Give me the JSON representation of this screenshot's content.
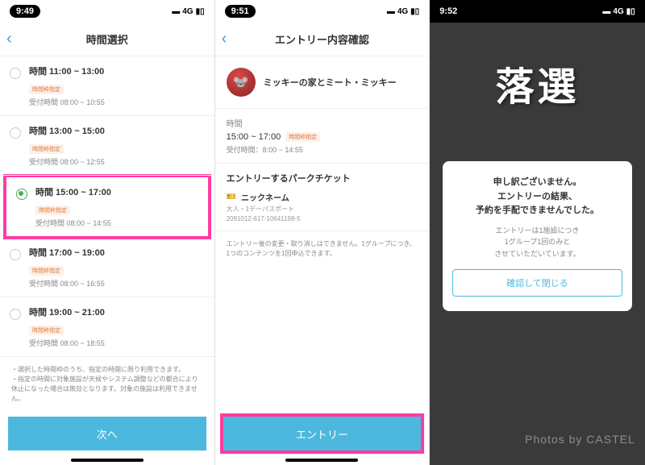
{
  "screen1": {
    "time": "9:49",
    "signal": "4G",
    "title": "時間選択",
    "slots": [
      {
        "title": "時間 11:00 ~ 13:00",
        "badge": "時間枠指定",
        "sub": "受付時間 08:00 ~ 10:55",
        "selected": false
      },
      {
        "title": "時間 13:00 ~ 15:00",
        "badge": "時間枠指定",
        "sub": "受付時間 08:00 ~ 12:55",
        "selected": false
      },
      {
        "title": "時間 15:00 ~ 17:00",
        "badge": "時間枠指定",
        "sub": "受付時間 08:00 ~ 14:55",
        "selected": true
      },
      {
        "title": "時間 17:00 ~ 19:00",
        "badge": "時間枠指定",
        "sub": "受付時間 08:00 ~ 16:55",
        "selected": false
      },
      {
        "title": "時間 19:00 ~ 21:00",
        "badge": "時間枠指定",
        "sub": "受付時間 08:00 ~ 18:55",
        "selected": false
      }
    ],
    "note1": "・選択した時間枠のうち、指定の時間に限り利用できます。",
    "note2": "・指定の時間に対象施設が天候やシステム調整などの都合により休止になった場合は無効となります。対象の施設は利用できません。",
    "next_btn": "次へ"
  },
  "screen2": {
    "time": "9:51",
    "signal": "4G",
    "title": "エントリー内容確認",
    "attraction_name": "ミッキーの家とミート・ミッキー",
    "time_label": "時間",
    "time_value": "15:00 ~ 17:00",
    "time_badge": "時間枠指定",
    "reception": "受付時間：8:00 ~ 14:55",
    "ticket_title": "エントリーするパークチケット",
    "ticket_name": "ニックネーム",
    "ticket_type": "大人・1デーパスポート",
    "ticket_id": "2091012-617-10641198-5",
    "warning": "エントリー後の変更・取り消しはできません。1グループにつき、1つのコンテンツを1回申込できます。",
    "entry_btn": "エントリー"
  },
  "screen3": {
    "time": "9:52",
    "signal": "4G",
    "big_text": "落選",
    "modal_line1": "申し訳ございません。",
    "modal_line2": "エントリーの結果、",
    "modal_line3": "予約を手配できませんでした。",
    "modal_sub1": "エントリーは1施設につき",
    "modal_sub2": "1グループ1回のみと",
    "modal_sub3": "させていただいています。",
    "modal_btn": "確認して閉じる",
    "watermark": "Photos by CASTEL"
  }
}
